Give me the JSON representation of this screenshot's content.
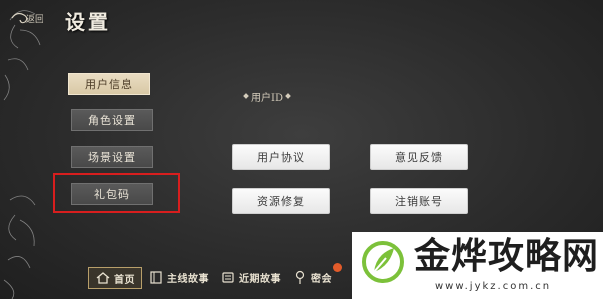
{
  "header": {
    "back_label": "返回",
    "title": "设置"
  },
  "menu": {
    "items": [
      {
        "label": "用户信息",
        "active": true
      },
      {
        "label": "角色设置",
        "active": false
      },
      {
        "label": "场景设置",
        "active": false
      },
      {
        "label": "礼包码",
        "active": false
      }
    ],
    "highlight_color": "#d81e1e"
  },
  "user_id": {
    "label": "用户ID"
  },
  "actions": {
    "user_agreement": "用户协议",
    "feedback": "意见反馈",
    "resource_repair": "资源修复",
    "logout": "注销账号"
  },
  "bottom_nav": {
    "home": "首页",
    "main_story": "主线故事",
    "recent_story": "近期故事",
    "secret": "密会"
  },
  "watermark": {
    "brand": "金烨攻略网",
    "url": "www.jykz.com.cn",
    "accent": "#7cc13a"
  }
}
